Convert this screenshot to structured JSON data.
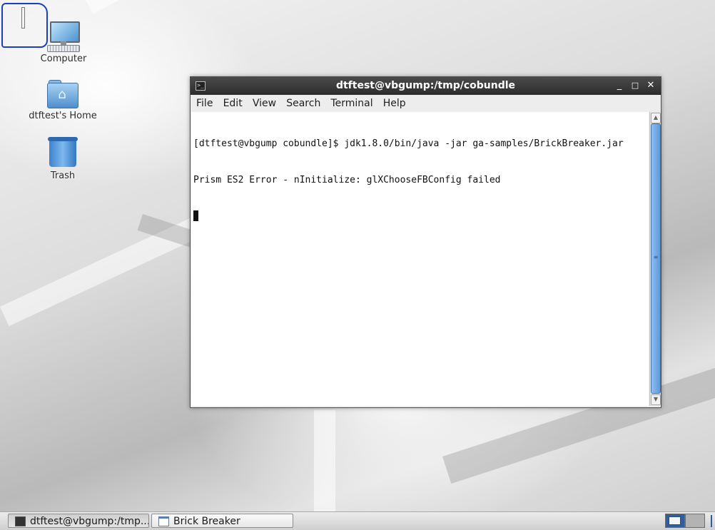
{
  "desktop": {
    "icons": [
      {
        "label": "Computer",
        "icon": "computer-icon"
      },
      {
        "label": "dtftest's Home",
        "icon": "home-folder-icon"
      },
      {
        "label": "Trash",
        "icon": "trash-icon"
      }
    ]
  },
  "terminal_window": {
    "title": "dtftest@vbgump:/tmp/cobundle",
    "controls": {
      "minimize": "_",
      "maximize": "□",
      "close": "✕"
    },
    "menu": [
      "File",
      "Edit",
      "View",
      "Search",
      "Terminal",
      "Help"
    ],
    "lines": [
      "[dtftest@vbgump cobundle]$ jdk1.8.0/bin/java -jar ga-samples/BrickBreaker.jar",
      "Prism ES2 Error - nInitialize: glXChooseFBConfig failed"
    ],
    "scroll": {
      "up": "▲",
      "down": "▼",
      "grip": "≡"
    }
  },
  "taskbar": {
    "tasks": [
      {
        "label": "dtftest@vbgump:/tmp...",
        "icon": "terminal-icon",
        "active": true
      },
      {
        "label": "Brick Breaker",
        "icon": "window-icon",
        "active": false
      }
    ]
  },
  "colors": {
    "titlebar": "#2c2c2c",
    "scroll_thumb": "#5d98db",
    "selection_rect": "#1c3fbf",
    "workspace_active": "#2e5f9e"
  }
}
